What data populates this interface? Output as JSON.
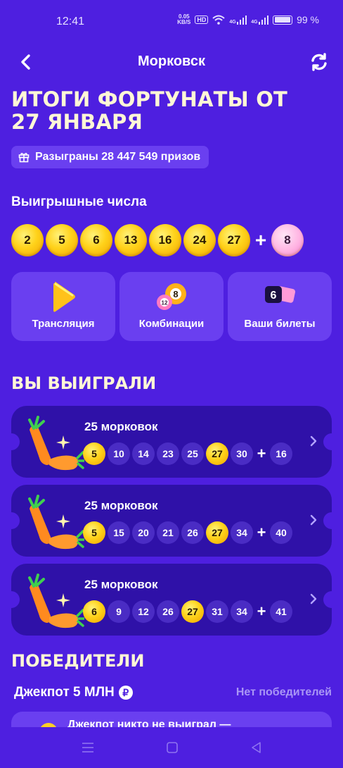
{
  "status_bar": {
    "time": "12:41",
    "speed_value": "0.05",
    "speed_unit": "KB/S",
    "hd": "HD",
    "net1": "4G",
    "net2": "4G",
    "battery": "99 %"
  },
  "header": {
    "title": "Морковск"
  },
  "page_title": "ИТОГИ ФОРТУНАТЫ ОТ 27 ЯНВАРЯ",
  "prizes_badge": "Разыграны 28 447 549 призов",
  "winning_numbers": {
    "label": "Выигрышные числа",
    "balls": [
      "2",
      "5",
      "6",
      "13",
      "16",
      "24",
      "27"
    ],
    "bonus": "8",
    "plus": "+"
  },
  "tiles": [
    {
      "label": "Трансляция",
      "icon": "play-icon"
    },
    {
      "label": "Комбинации",
      "icon": "lottery-balls-icon"
    },
    {
      "label": "Ваши билеты",
      "icon": "tickets-icon",
      "badge": "6"
    }
  ],
  "you_won": {
    "heading": "ВЫ ВЫИГРАЛИ",
    "tickets": [
      {
        "amount": "25 морковок",
        "balls": [
          {
            "n": "5",
            "hit": true
          },
          {
            "n": "10",
            "hit": false
          },
          {
            "n": "14",
            "hit": false
          },
          {
            "n": "23",
            "hit": false
          },
          {
            "n": "25",
            "hit": false
          },
          {
            "n": "27",
            "hit": true
          },
          {
            "n": "30",
            "hit": false
          }
        ],
        "bonus": "16"
      },
      {
        "amount": "25 морковок",
        "balls": [
          {
            "n": "5",
            "hit": true
          },
          {
            "n": "15",
            "hit": false
          },
          {
            "n": "20",
            "hit": false
          },
          {
            "n": "21",
            "hit": false
          },
          {
            "n": "26",
            "hit": false
          },
          {
            "n": "27",
            "hit": true
          },
          {
            "n": "34",
            "hit": false
          }
        ],
        "bonus": "40"
      },
      {
        "amount": "25 морковок",
        "balls": [
          {
            "n": "6",
            "hit": true
          },
          {
            "n": "9",
            "hit": false
          },
          {
            "n": "12",
            "hit": false
          },
          {
            "n": "26",
            "hit": false
          },
          {
            "n": "27",
            "hit": true
          },
          {
            "n": "31",
            "hit": false
          },
          {
            "n": "34",
            "hit": false
          }
        ],
        "bonus": "41"
      }
    ]
  },
  "winners": {
    "heading": "ПОБЕДИТЕЛИ",
    "jackpot_label": "Джекпот 5 МЛН",
    "currency_symbol": "₽",
    "no_winners": "Нет победителей",
    "card_text": "Джекпот никто не выиграл —"
  },
  "colors": {
    "background": "#4e1fe0",
    "tile": "#6a3ff0",
    "ticket": "#2f11a8",
    "gold_ball": "#ffd21a",
    "pink_ball": "#ffb3e2",
    "title_text": "#fff7d6"
  }
}
